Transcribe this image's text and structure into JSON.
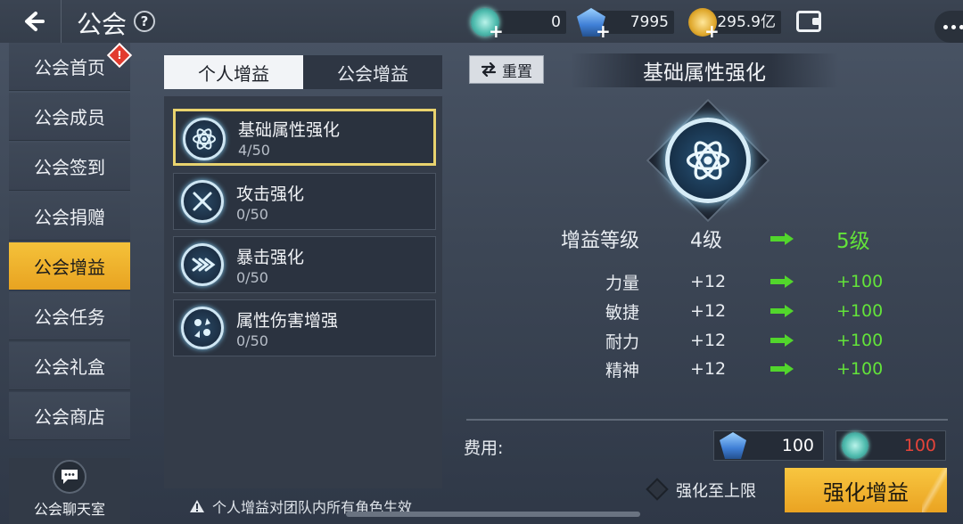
{
  "header": {
    "title": "公会",
    "help_symbol": "?",
    "currencies": [
      {
        "name": "crystal",
        "value": "0",
        "icon": "crystal-orb-icon",
        "color": "#6fd8d0"
      },
      {
        "name": "diamond",
        "value": "7995",
        "icon": "blue-diamond-icon",
        "color": "#4a8fe0"
      },
      {
        "name": "gold",
        "value": "295.9亿",
        "icon": "gold-coin-icon",
        "color": "#e2b23a"
      }
    ]
  },
  "sidebar": {
    "items": [
      {
        "label": "公会首页",
        "badge": "!"
      },
      {
        "label": "公会成员"
      },
      {
        "label": "公会签到"
      },
      {
        "label": "公会捐赠"
      },
      {
        "label": "公会增益"
      },
      {
        "label": "公会任务"
      },
      {
        "label": "公会礼盒"
      },
      {
        "label": "公会商店"
      }
    ],
    "chat_label": "公会聊天室",
    "active_index": 4
  },
  "tabs": [
    {
      "label": "个人增益",
      "active": true
    },
    {
      "label": "公会增益",
      "active": false
    }
  ],
  "buffs": [
    {
      "name": "基础属性强化",
      "level": "4/50",
      "icon": "atom-icon",
      "selected": true
    },
    {
      "name": "攻击强化",
      "level": "0/50",
      "icon": "crossed-swords-icon",
      "selected": false
    },
    {
      "name": "暴击强化",
      "level": "0/50",
      "icon": "critical-arrow-icon",
      "selected": false
    },
    {
      "name": "属性伤害增强",
      "level": "0/50",
      "icon": "elements-icon",
      "selected": false
    }
  ],
  "note": "个人增益对团队内所有角色生效",
  "detail": {
    "reset_label": "重置",
    "title": "基础属性强化",
    "level_label": "增益等级",
    "level_current": "4级",
    "level_next": "5级",
    "stats": [
      {
        "label": "力量",
        "current": "+12",
        "next": "+100"
      },
      {
        "label": "敏捷",
        "current": "+12",
        "next": "+100"
      },
      {
        "label": "耐力",
        "current": "+12",
        "next": "+100"
      },
      {
        "label": "精神",
        "current": "+12",
        "next": "+100"
      }
    ],
    "cost_label": "费用:",
    "costs": [
      {
        "icon": "blue-diamond-icon",
        "value": "100",
        "color": "#ffffff"
      },
      {
        "icon": "crystal-orb-icon",
        "value": "100",
        "color": "#e5443a"
      }
    ],
    "max_label": "强化至上限",
    "enhance_label": "强化增益"
  }
}
